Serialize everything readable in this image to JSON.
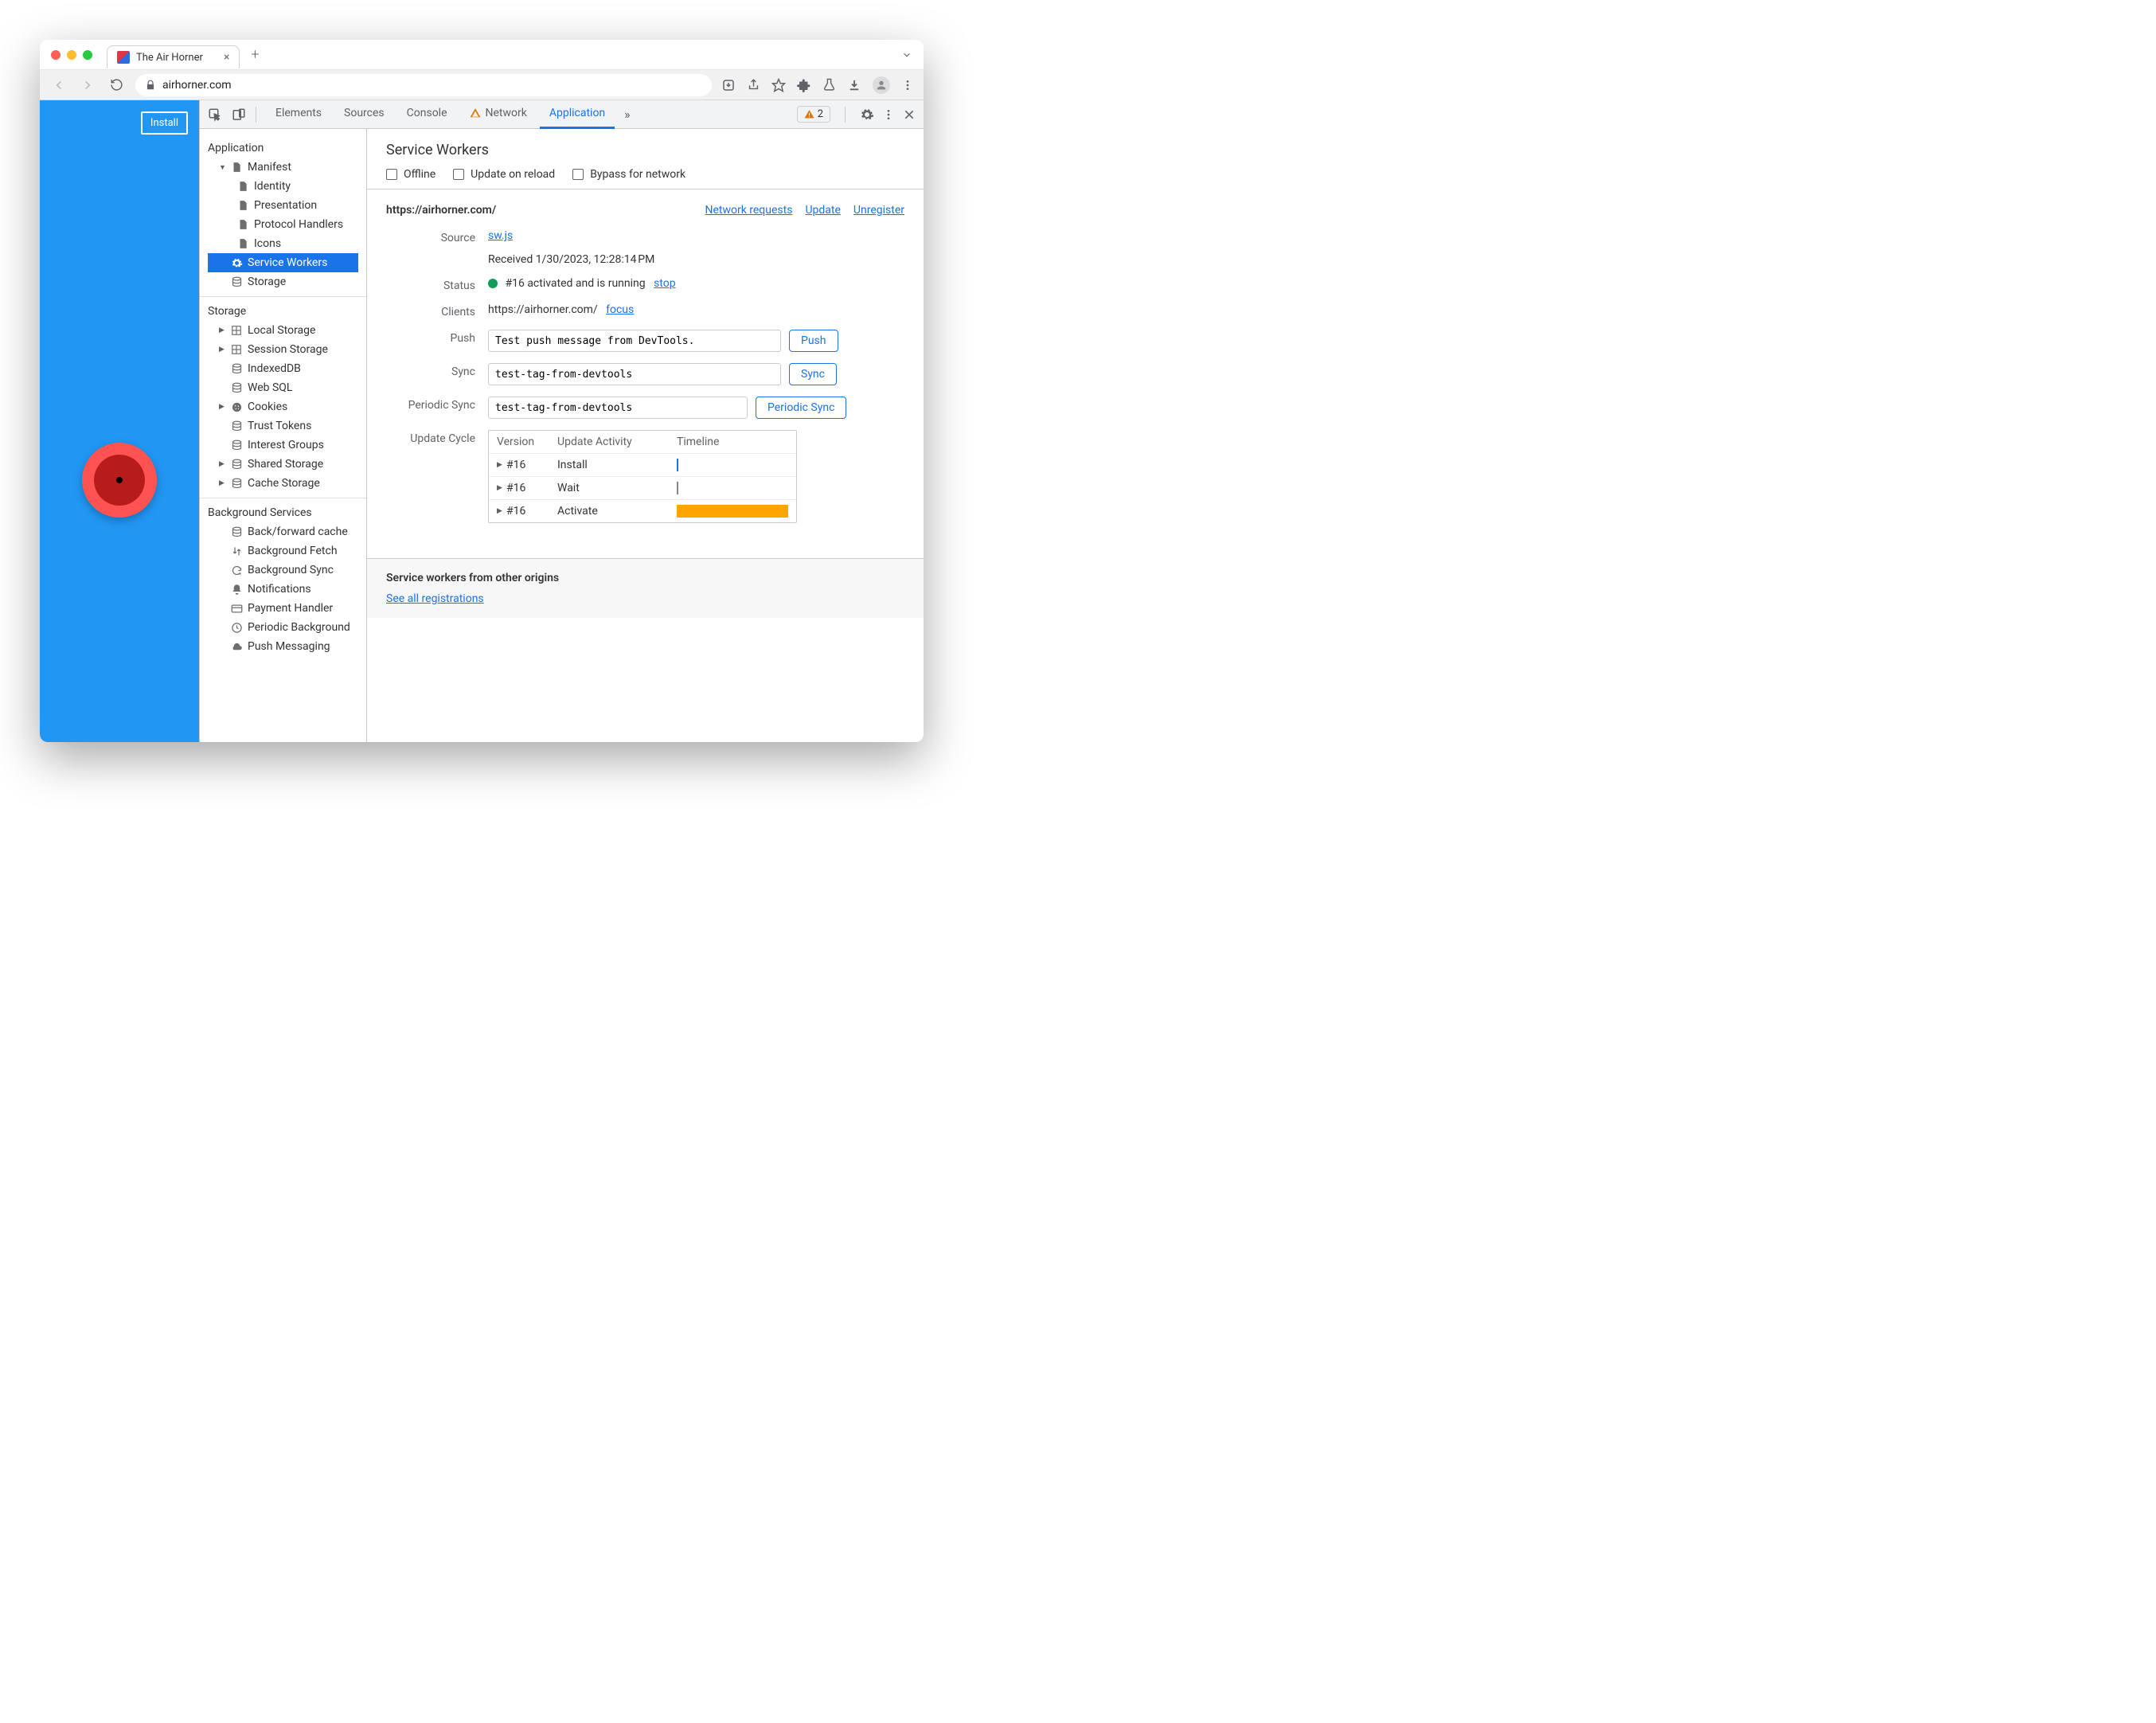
{
  "browser": {
    "tab_title": "The Air Horner",
    "url": "airhorner.com"
  },
  "page": {
    "install_label": "Install"
  },
  "devtools": {
    "tabs": {
      "elements": "Elements",
      "sources": "Sources",
      "console": "Console",
      "network": "Network",
      "application": "Application"
    },
    "warning_count": "2"
  },
  "sidebar": {
    "groups": {
      "application": {
        "title": "Application",
        "items": {
          "manifest": "Manifest",
          "identity": "Identity",
          "presentation": "Presentation",
          "protocol": "Protocol Handlers",
          "icons": "Icons",
          "service_workers": "Service Workers",
          "storage": "Storage"
        }
      },
      "storage": {
        "title": "Storage",
        "items": {
          "local": "Local Storage",
          "session": "Session Storage",
          "indexeddb": "IndexedDB",
          "websql": "Web SQL",
          "cookies": "Cookies",
          "trust": "Trust Tokens",
          "interest": "Interest Groups",
          "shared": "Shared Storage",
          "cache": "Cache Storage"
        }
      },
      "background": {
        "title": "Background Services",
        "items": {
          "bfcache": "Back/forward cache",
          "bgfetch": "Background Fetch",
          "bgsync": "Background Sync",
          "notifications": "Notifications",
          "payment": "Payment Handler",
          "periodic": "Periodic Background",
          "push": "Push Messaging"
        }
      }
    }
  },
  "panel": {
    "title": "Service Workers",
    "checks": {
      "offline": "Offline",
      "update": "Update on reload",
      "bypass": "Bypass for network"
    },
    "origin": "https://airhorner.com/",
    "links": {
      "network": "Network requests",
      "update": "Update",
      "unregister": "Unregister"
    },
    "rows": {
      "source": {
        "label": "Source",
        "link": "sw.js",
        "received": "Received 1/30/2023, 12:28:14 PM"
      },
      "status": {
        "label": "Status",
        "text": "#16 activated and is running",
        "action": "stop"
      },
      "clients": {
        "label": "Clients",
        "text": "https://airhorner.com/",
        "action": "focus"
      },
      "push": {
        "label": "Push",
        "value": "Test push message from DevTools.",
        "button": "Push"
      },
      "sync": {
        "label": "Sync",
        "value": "test-tag-from-devtools",
        "button": "Sync"
      },
      "psync": {
        "label": "Periodic Sync",
        "value": "test-tag-from-devtools",
        "button": "Periodic Sync"
      },
      "cycle": {
        "label": "Update Cycle",
        "cols": {
          "version": "Version",
          "activity": "Update Activity",
          "timeline": "Timeline"
        },
        "rows": [
          {
            "version": "#16",
            "activity": "Install",
            "tl": "tick-blue"
          },
          {
            "version": "#16",
            "activity": "Wait",
            "tl": "tick-gray"
          },
          {
            "version": "#16",
            "activity": "Activate",
            "tl": "bar"
          }
        ]
      }
    },
    "other": {
      "title": "Service workers from other origins",
      "link": "See all registrations"
    }
  }
}
